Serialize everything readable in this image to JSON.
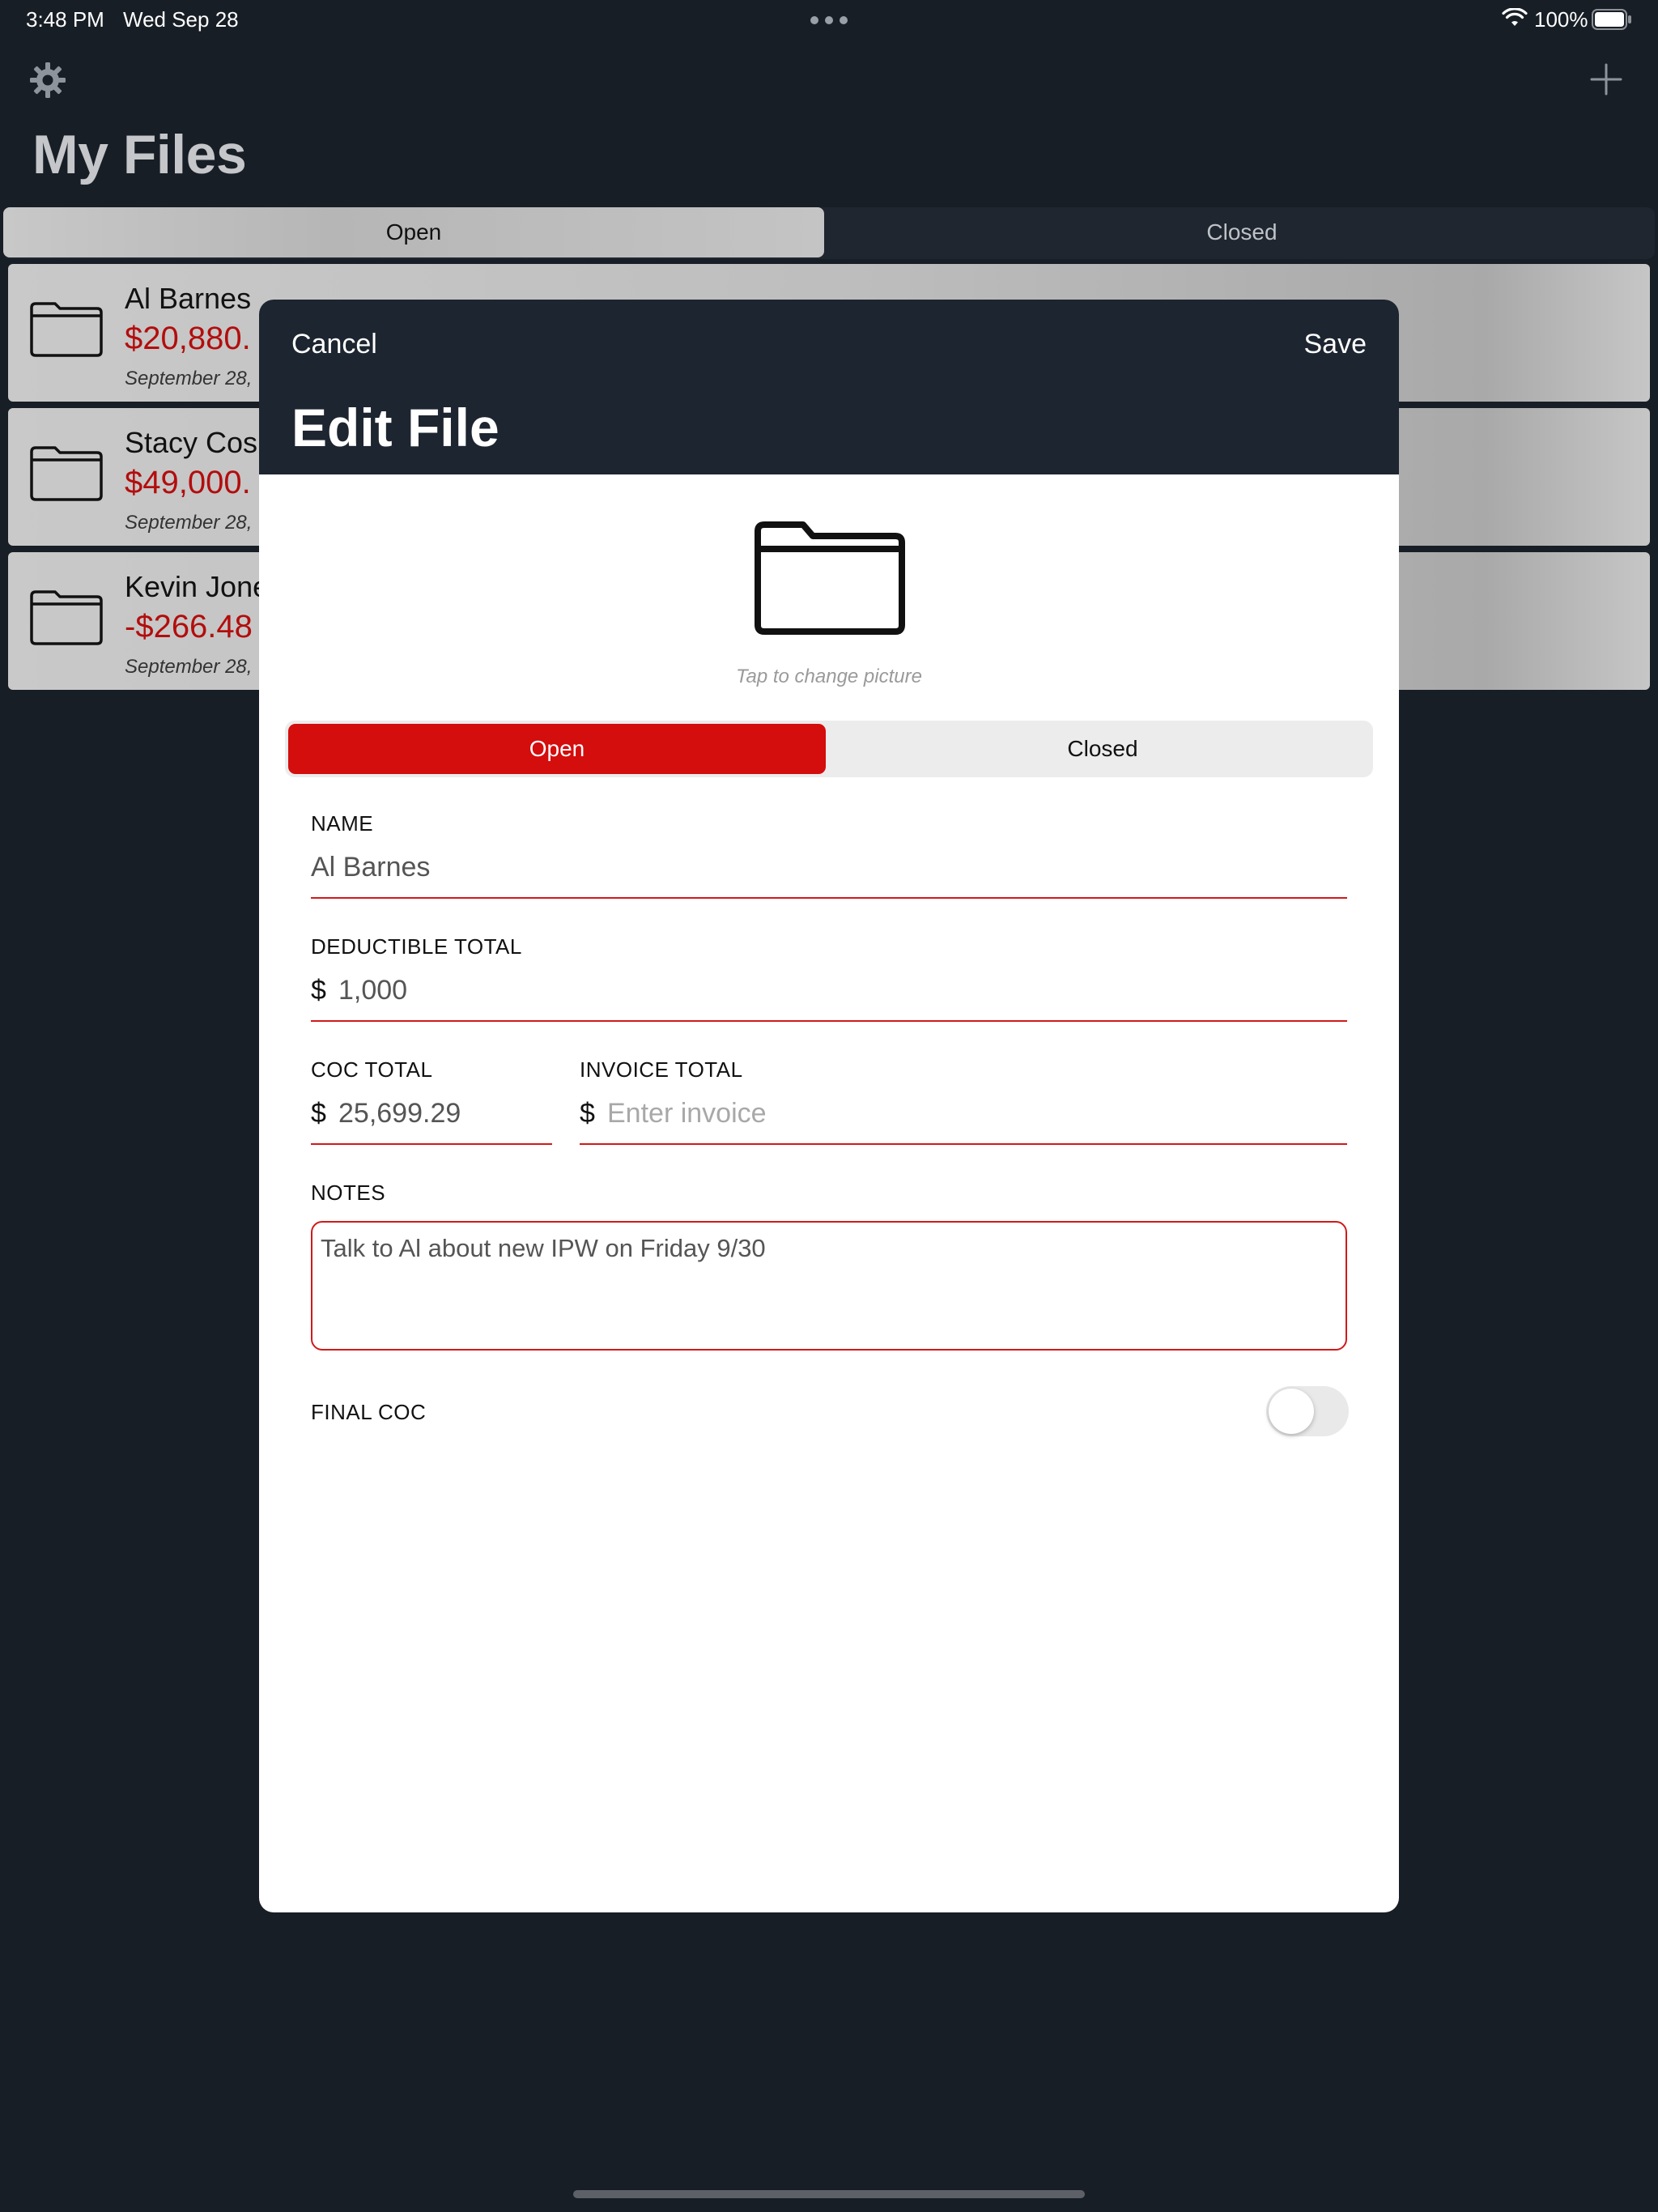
{
  "status_bar": {
    "time": "3:48 PM",
    "date": "Wed Sep 28",
    "battery_pct": "100%"
  },
  "background": {
    "title": "My Files",
    "segment": {
      "open_label": "Open",
      "closed_label": "Closed",
      "selected": "Open"
    },
    "cards": [
      {
        "name": "Al Barnes",
        "amount": "$20,880.",
        "date": "September 28,"
      },
      {
        "name": "Stacy Cos",
        "amount": "$49,000.",
        "date": "September 28,"
      },
      {
        "name": "Kevin Jone",
        "amount": "-$266.48",
        "date": "September 28,"
      }
    ]
  },
  "modal": {
    "cancel_label": "Cancel",
    "save_label": "Save",
    "title": "Edit File",
    "picture_hint": "Tap to change picture",
    "segment": {
      "open_label": "Open",
      "closed_label": "Closed",
      "selected": "Open"
    },
    "fields": {
      "name": {
        "label": "NAME",
        "value": "Al Barnes"
      },
      "deductible": {
        "label": "DEDUCTIBLE TOTAL",
        "currency": "$",
        "value": "1,000"
      },
      "coc": {
        "label": "COC TOTAL",
        "currency": "$",
        "value": "25,699.29"
      },
      "invoice": {
        "label": "INVOICE TOTAL",
        "currency": "$",
        "value": "",
        "placeholder": "Enter invoice"
      },
      "notes": {
        "label": "NOTES",
        "value": "Talk to Al about new IPW on Friday 9/30"
      },
      "final_coc": {
        "label": "FINAL COC",
        "on": false
      }
    }
  },
  "colors": {
    "accent_red": "#d40d0d",
    "header_bg": "#1d2530",
    "app_bg": "#181e26"
  },
  "icons": [
    "gear-icon",
    "plus-icon",
    "folder-icon",
    "wifi-icon",
    "battery-icon"
  ]
}
